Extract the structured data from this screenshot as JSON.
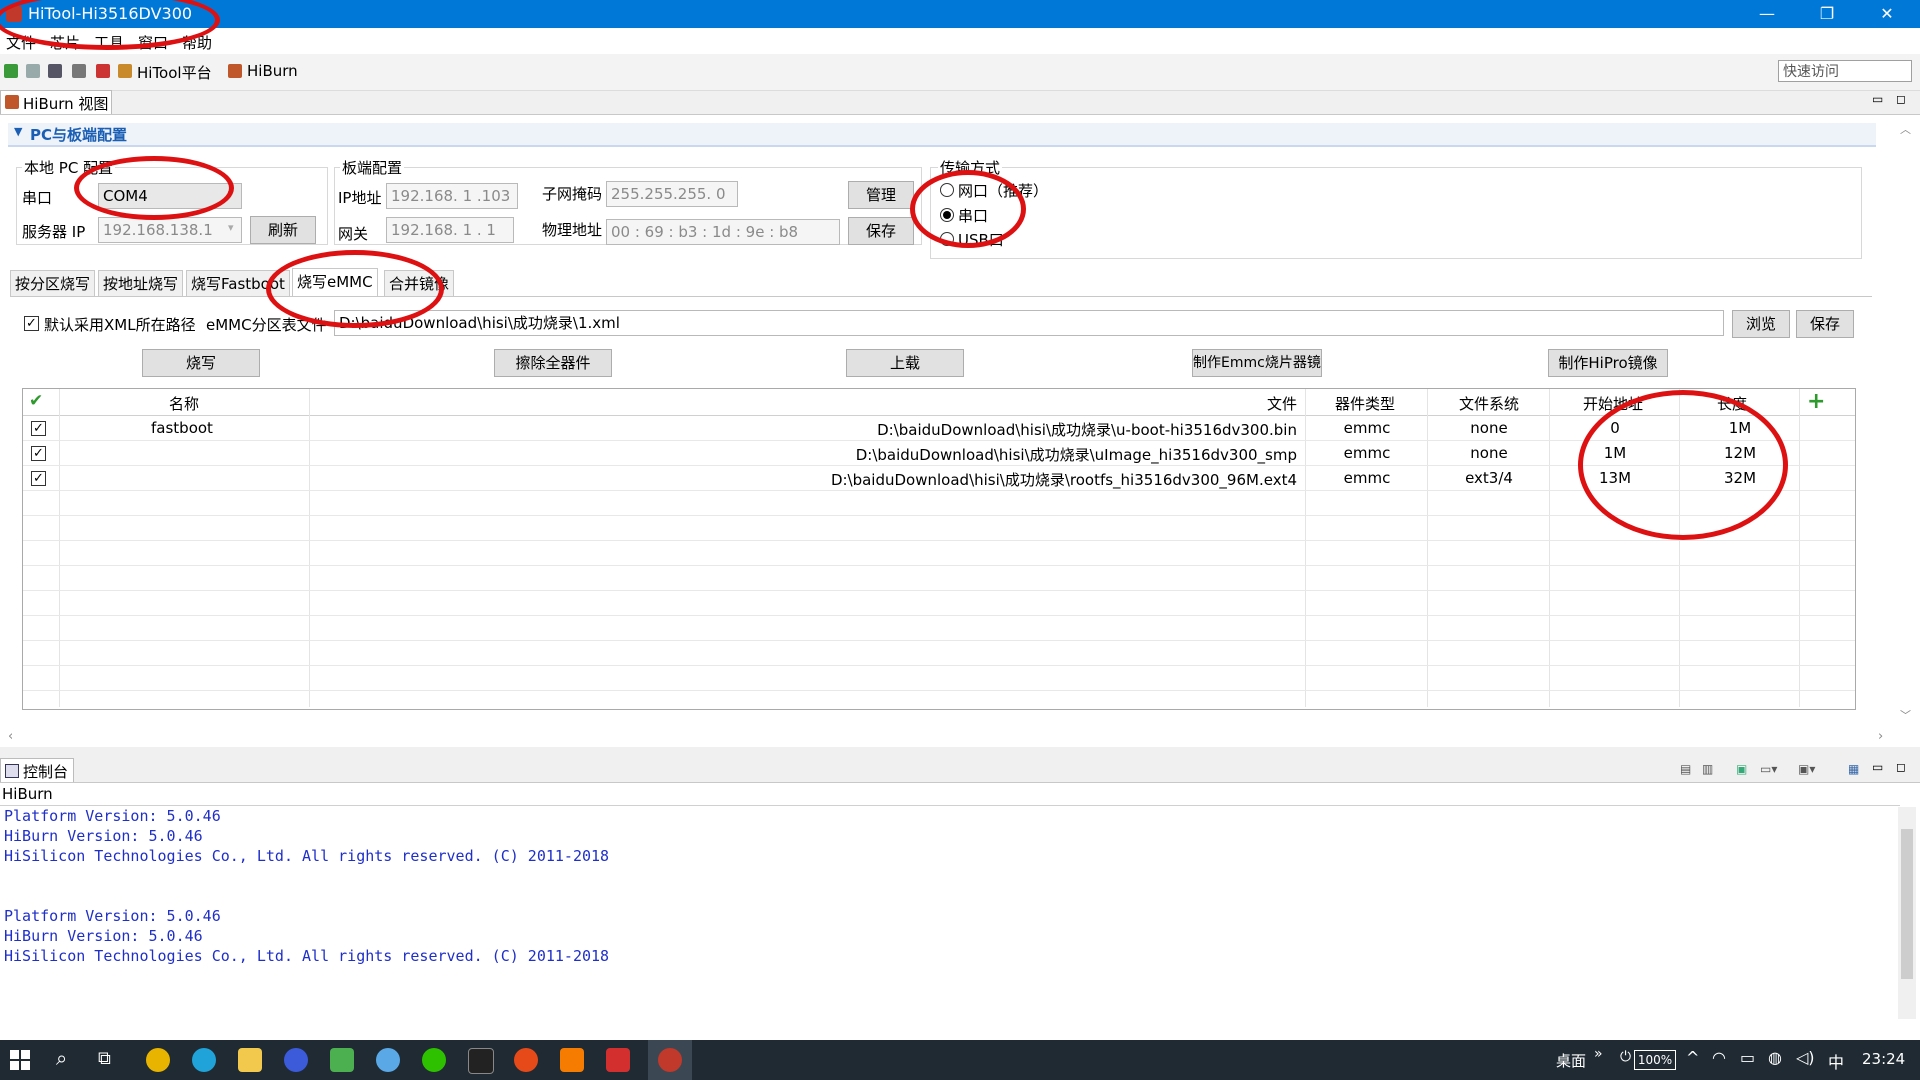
{
  "window": {
    "title": "HiTool-Hi3516DV300",
    "min": "—",
    "max": "❐",
    "close": "✕"
  },
  "menu": [
    "文件",
    "芯片",
    "工具",
    "窗口",
    "帮助"
  ],
  "toolbar": {
    "hitool_label": "HiTool平台",
    "hiburn_label": "HiBurn",
    "quick_access": "快速访问"
  },
  "view": {
    "tab_label": "HiBurn 视图",
    "section_title": "PC与板端配置",
    "local_pc": {
      "title": "本地 PC 配置",
      "serial_label": "串口",
      "serial_value": "COM4",
      "server_ip_label": "服务器 IP",
      "server_ip_value": "192.168.138.1",
      "refresh_button": "刷新"
    },
    "board": {
      "title": "板端配置",
      "ip_label": "IP地址",
      "ip_value": "192.168.  1  .103",
      "subnet_label": "子网掩码",
      "subnet_value": "255.255.255.  0",
      "gateway_label": "网关",
      "gateway_value": "192.168.  1  .  1",
      "mac_label": "物理地址",
      "mac_value": "00 : 69 : b3 : 1d : 9e : b8",
      "manage_button": "管理",
      "save_button": "保存"
    },
    "transfer": {
      "title": "传输方式",
      "options": [
        "网口（推荐）",
        "串口",
        "USB口"
      ],
      "selected": "串口"
    },
    "subtabs": [
      "按分区烧写",
      "按地址烧写",
      "烧写Fastboot",
      "烧写eMMC",
      "合并镜像"
    ],
    "active_subtab": "烧写eMMC",
    "xml_checkbox_label": "默认采用XML所在路径",
    "emmc_table_label": "eMMC分区表文件",
    "emmc_table_path": "D:\\baiduDownload\\hisi\\成功烧录\\1.xml",
    "browse_button": "浏览",
    "save_button": "保存",
    "actions": [
      "烧写",
      "擦除全器件",
      "上载",
      "制作Emmc烧片器镜像",
      "制作HiPro镜像"
    ],
    "table": {
      "headers": [
        "名称",
        "文件",
        "器件类型",
        "文件系统",
        "开始地址",
        "长度"
      ],
      "rows": [
        {
          "checked": true,
          "name": "fastboot",
          "file": "D:\\baiduDownload\\hisi\\成功烧录\\u-boot-hi3516dv300.bin",
          "device": "emmc",
          "fs": "none",
          "start": "0",
          "length": "1M"
        },
        {
          "checked": true,
          "name": "",
          "file": "D:\\baiduDownload\\hisi\\成功烧录\\uImage_hi3516dv300_smp",
          "device": "emmc",
          "fs": "none",
          "start": "1M",
          "length": "12M"
        },
        {
          "checked": true,
          "name": "",
          "file": "D:\\baiduDownload\\hisi\\成功烧录\\rootfs_hi3516dv300_96M.ext4",
          "device": "emmc",
          "fs": "ext3/4",
          "start": "13M",
          "length": "32M"
        }
      ]
    }
  },
  "console": {
    "tab_label": "控制台",
    "source": "HiBurn",
    "lines": [
      "Platform Version: 5.0.46",
      "HiBurn Version: 5.0.46",
      "HiSilicon Technologies Co., Ltd. All rights reserved. (C) 2011-2018",
      "",
      "",
      "Platform Version: 5.0.46",
      "HiBurn Version: 5.0.46",
      "HiSilicon Technologies Co., Ltd. All rights reserved. (C) 2011-2018"
    ]
  },
  "taskbar": {
    "desktop_label": "桌面",
    "battery": "100%",
    "ime": "中",
    "time": "23:24"
  },
  "colors": {
    "titlebar": "#0078d7",
    "annotation": "#dd1111",
    "console_text": "#1f2fc9",
    "taskbar": "#1f2a33"
  }
}
